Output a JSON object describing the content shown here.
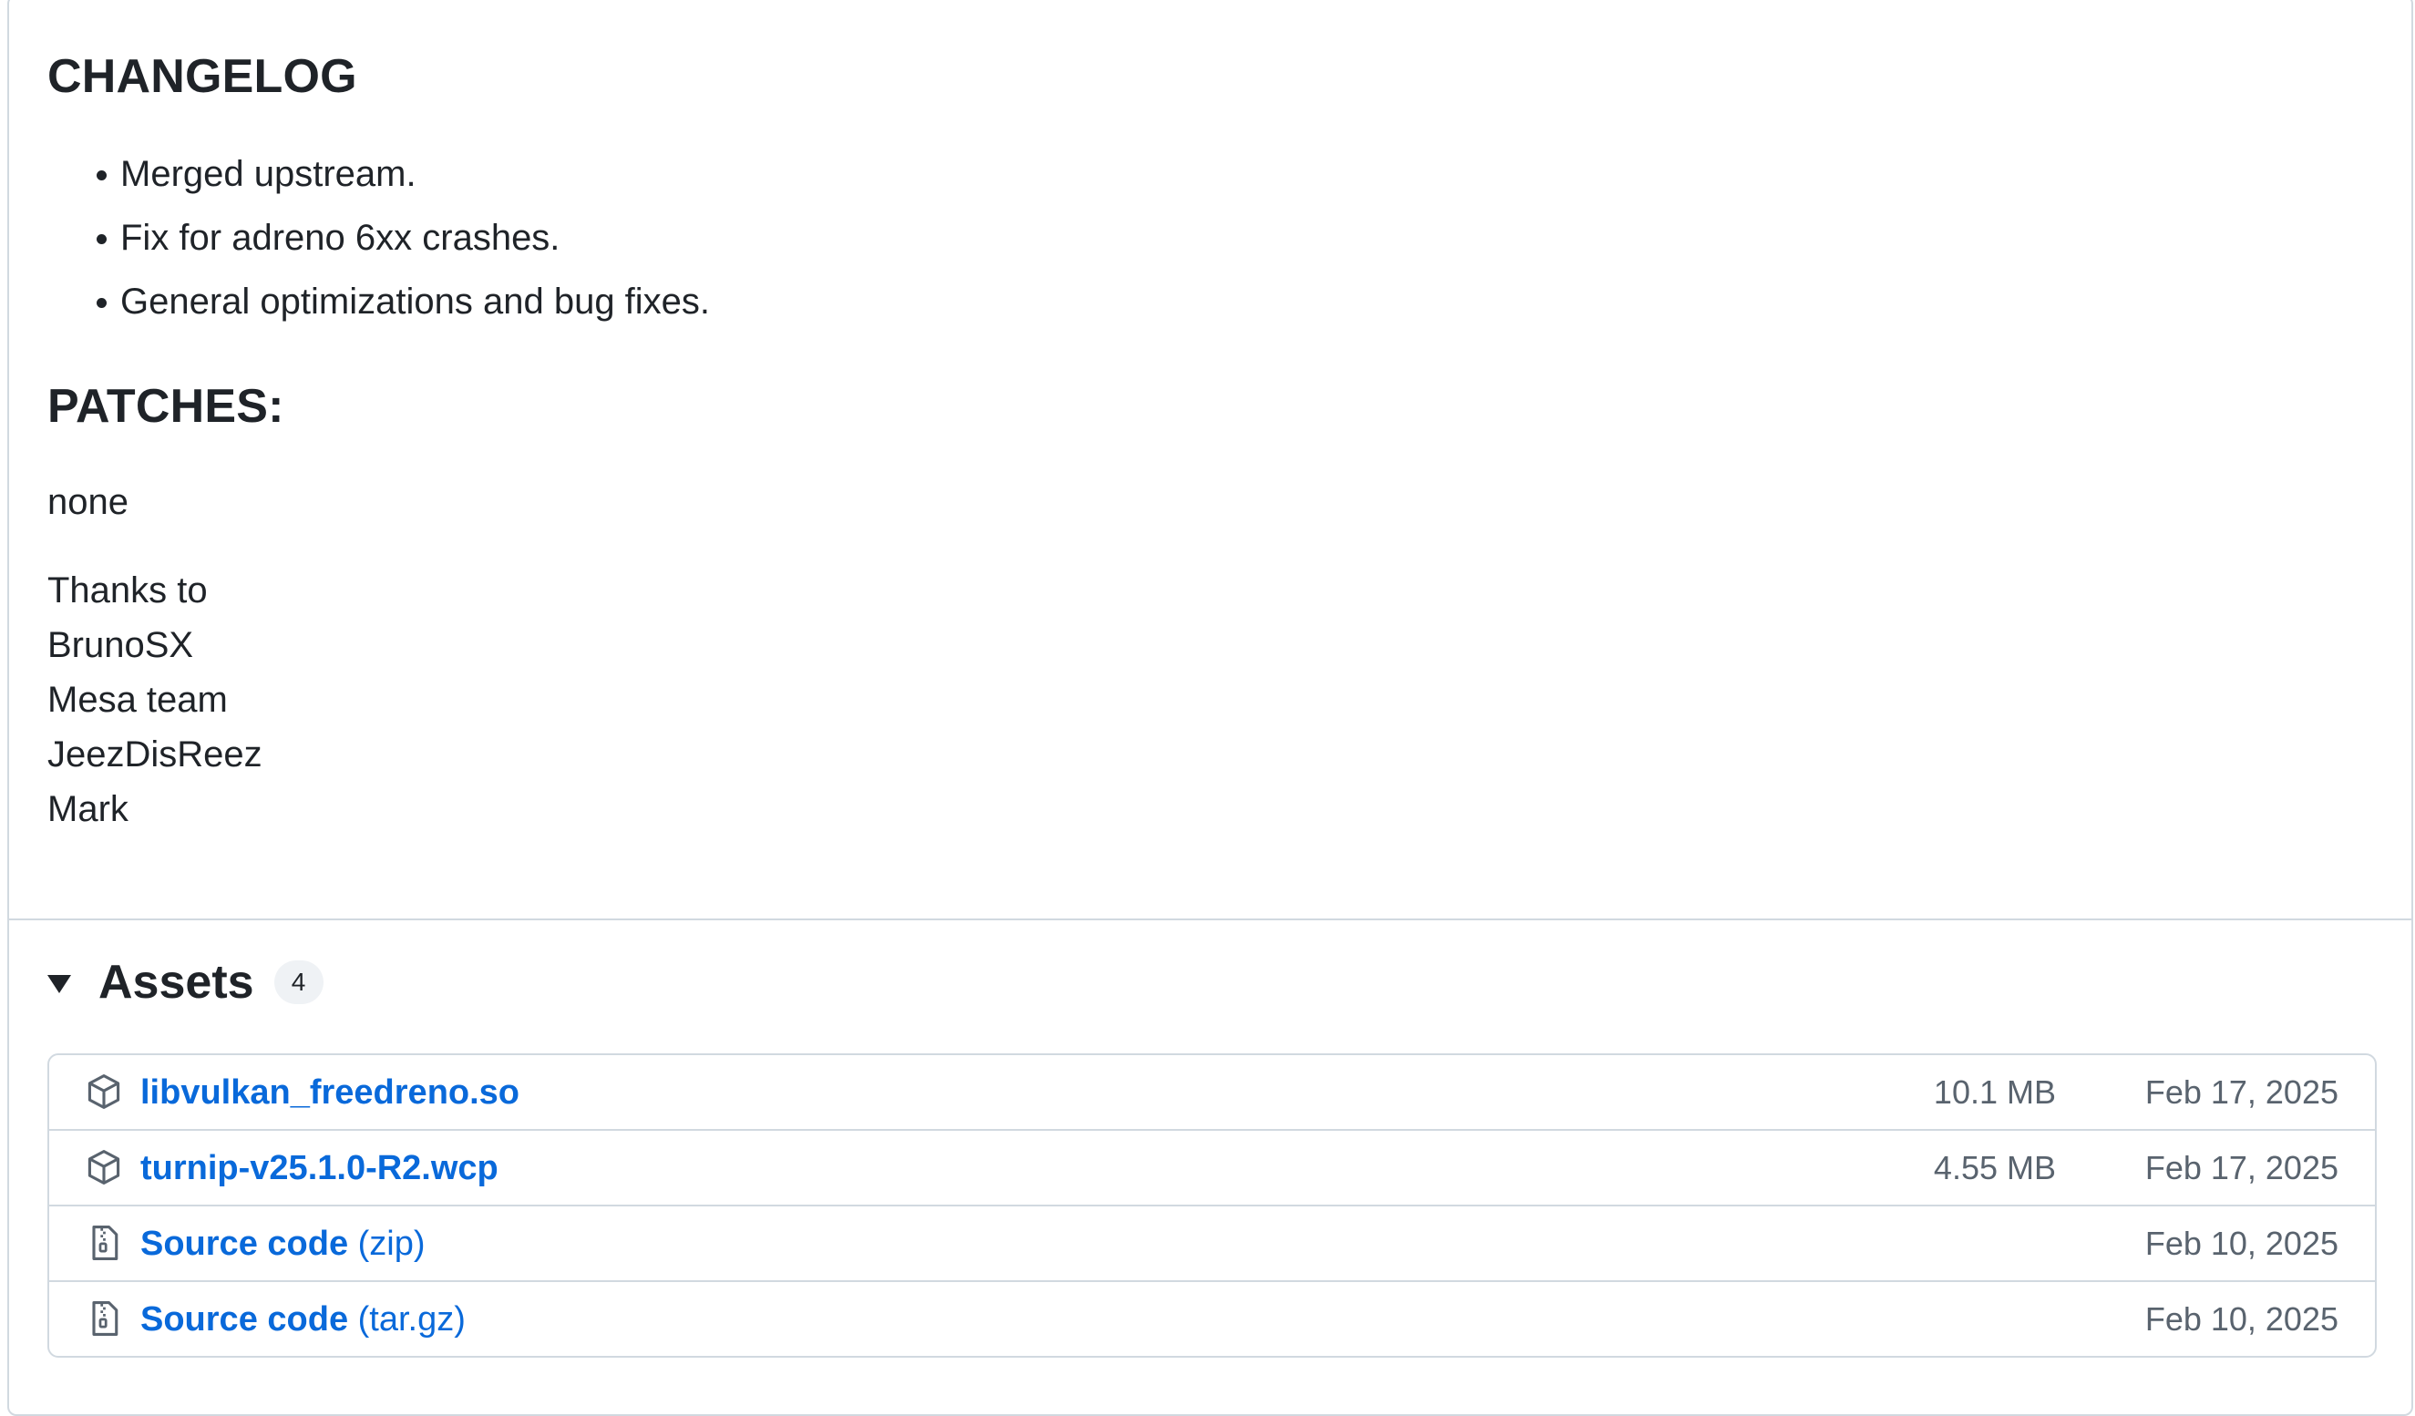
{
  "release_notes": {
    "changelog_heading": "CHANGELOG",
    "changelog_items": [
      "Merged upstream.",
      "Fix for adreno 6xx crashes.",
      "General optimizations and bug fixes."
    ],
    "patches_heading": "PATCHES:",
    "patches_text": "none",
    "thanks_lines": [
      "Thanks to",
      "BrunoSX",
      "Mesa team",
      "JeezDisReez",
      "Mark"
    ]
  },
  "assets": {
    "title": "Assets",
    "count": "4",
    "items": [
      {
        "icon": "package-icon",
        "name": "libvulkan_freedreno.so",
        "suffix": "",
        "size": "10.1 MB",
        "date": "Feb 17, 2025"
      },
      {
        "icon": "package-icon",
        "name": "turnip-v25.1.0-R2.wcp",
        "suffix": "",
        "size": "4.55 MB",
        "date": "Feb 17, 2025"
      },
      {
        "icon": "file-zip-icon",
        "name": "Source code",
        "suffix": "(zip)",
        "size": "",
        "date": "Feb 10, 2025"
      },
      {
        "icon": "file-zip-icon",
        "name": "Source code",
        "suffix": "(tar.gz)",
        "size": "",
        "date": "Feb 10, 2025"
      }
    ]
  },
  "colors": {
    "link": "#0969da",
    "muted": "#59636e",
    "border": "#d1d9e0",
    "text": "#1f2328"
  }
}
